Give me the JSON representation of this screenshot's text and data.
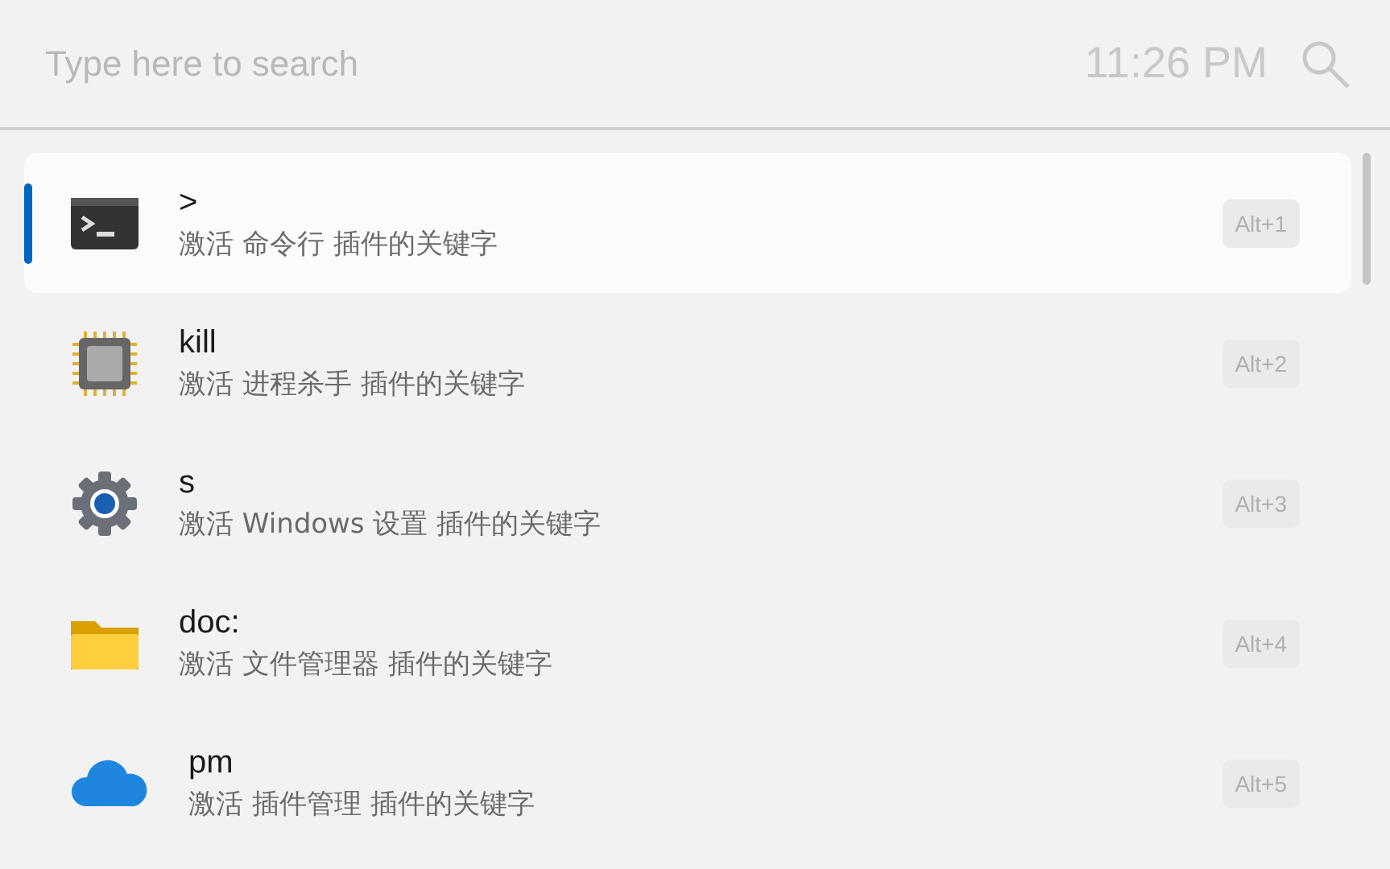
{
  "search": {
    "placeholder": "Type here to search",
    "time": "11:26 PM"
  },
  "results": [
    {
      "title": ">",
      "subtitle": "激活 命令行 插件的关键字",
      "shortcut": "Alt+1",
      "selected": true
    },
    {
      "title": "kill",
      "subtitle": "激活 进程杀手 插件的关键字",
      "shortcut": "Alt+2",
      "selected": false
    },
    {
      "title": "s",
      "subtitle": "激活 Windows 设置 插件的关键字",
      "shortcut": "Alt+3",
      "selected": false
    },
    {
      "title": "doc:",
      "subtitle": "激活 文件管理器 插件的关键字",
      "shortcut": "Alt+4",
      "selected": false
    },
    {
      "title": "pm",
      "subtitle": "激活 插件管理 插件的关键字",
      "shortcut": "Alt+5",
      "selected": false
    }
  ]
}
